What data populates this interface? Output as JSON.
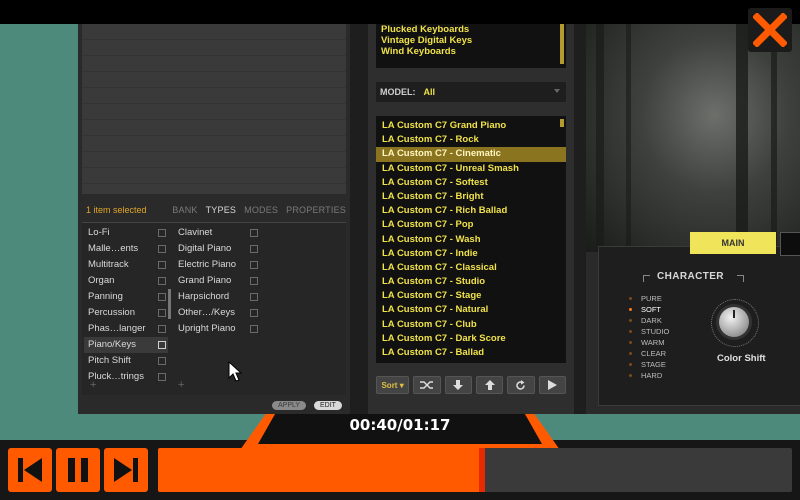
{
  "app": {
    "browser": {
      "selection_count": "1 item selected",
      "tabs": [
        {
          "label": "BANK",
          "active": false
        },
        {
          "label": "TYPES",
          "active": true
        },
        {
          "label": "MODES",
          "active": false
        },
        {
          "label": "PROPERTIES",
          "active": false
        }
      ],
      "types_col1": [
        {
          "label": "Lo-Fi",
          "checked": false
        },
        {
          "label": "Malle…ents",
          "checked": false
        },
        {
          "label": "Multitrack",
          "checked": false
        },
        {
          "label": "Organ",
          "checked": false
        },
        {
          "label": "Panning",
          "checked": false
        },
        {
          "label": "Percussion",
          "checked": false
        },
        {
          "label": "Phas…langer",
          "checked": false
        },
        {
          "label": "Piano/Keys",
          "checked": true
        },
        {
          "label": "Pitch Shift",
          "checked": false
        },
        {
          "label": "Pluck…trings",
          "checked": false
        }
      ],
      "types_col2": [
        {
          "label": "Clavinet",
          "checked": false
        },
        {
          "label": "Digital Piano",
          "checked": false
        },
        {
          "label": "Electric Piano",
          "checked": false
        },
        {
          "label": "Grand Piano",
          "checked": false
        },
        {
          "label": "Harpsichord",
          "checked": false
        },
        {
          "label": "Other…/Keys",
          "checked": false
        },
        {
          "label": "Upright Piano",
          "checked": false
        }
      ],
      "plus_symbol": "+",
      "apply_label": "APPLY",
      "edit_label": "EDIT"
    },
    "categories": [
      "Plucked Keyboards",
      "Vintage Digital Keys",
      "Wind Keyboards"
    ],
    "model": {
      "label": "MODEL:",
      "value": "All"
    },
    "presets": [
      "LA Custom C7 Grand Piano",
      "LA Custom C7 - Rock",
      "LA Custom C7 - Cinematic",
      "LA Custom C7 - Unreal Smash",
      "LA Custom C7 - Softest",
      "LA Custom C7 - Bright",
      "LA Custom C7 - Rich Ballad",
      "LA Custom C7 - Pop",
      "LA Custom C7 - Wash",
      "LA Custom C7 - Indie",
      "LA Custom C7 - Classical",
      "LA Custom C7 - Studio",
      "LA Custom C7 - Stage",
      "LA Custom C7 - Natural",
      "LA Custom C7 - Club",
      "LA Custom C7 - Dark Score",
      "LA Custom C7 - Ballad"
    ],
    "selected_preset_index": 2,
    "toolbar": {
      "sort_label": "Sort ▾",
      "icons": [
        "shuffle-icon",
        "arrow-down-icon",
        "arrow-up-icon",
        "refresh-icon",
        "play-icon"
      ]
    },
    "instrument": {
      "main_tab": "MAIN",
      "character_title": "CHARACTER",
      "character_options": [
        {
          "label": "PURE",
          "active": false
        },
        {
          "label": "SOFT",
          "active": true
        },
        {
          "label": "DARK",
          "active": false
        },
        {
          "label": "STUDIO",
          "active": false
        },
        {
          "label": "WARM",
          "active": false
        },
        {
          "label": "CLEAR",
          "active": false
        },
        {
          "label": "STAGE",
          "active": false
        },
        {
          "label": "HARD",
          "active": false
        }
      ],
      "knob_label": "Color Shift"
    }
  },
  "player": {
    "time": "00:40/01:17",
    "progress": 0.516,
    "accent_color": "#ff5a00"
  }
}
